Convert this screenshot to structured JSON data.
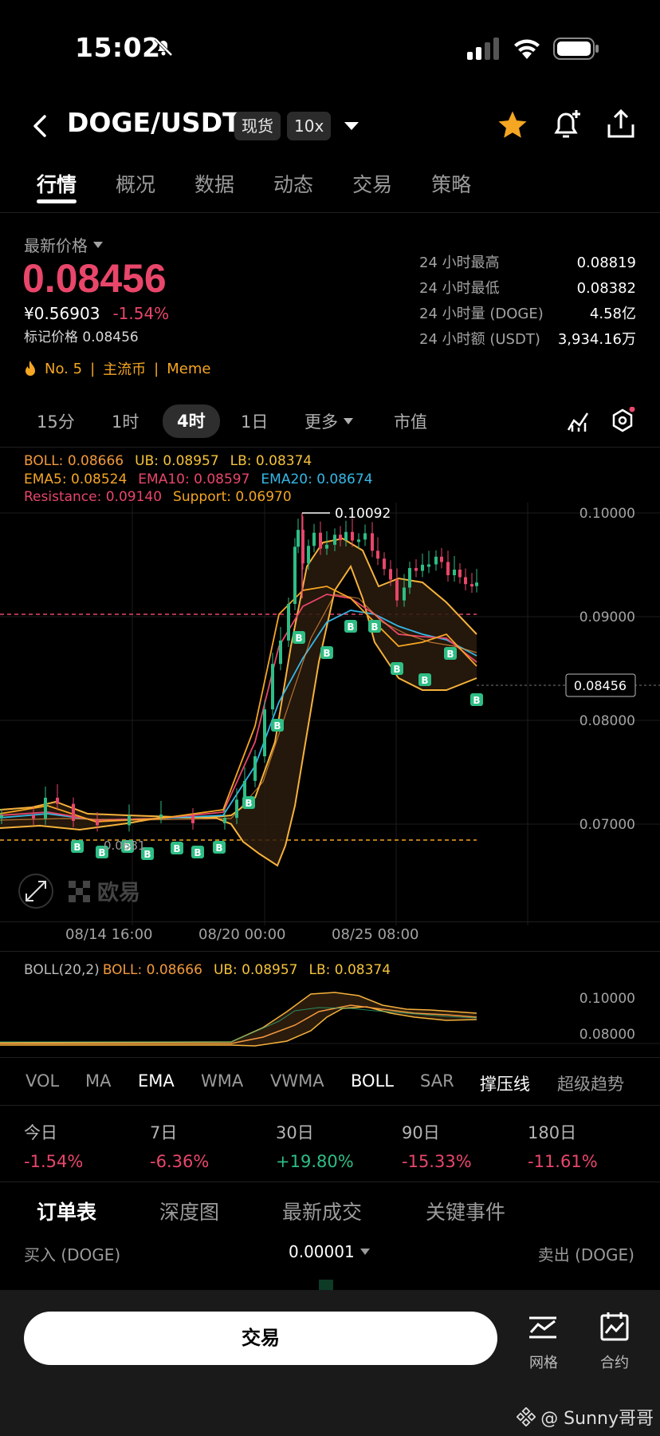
{
  "status": {
    "time": "15:02"
  },
  "header": {
    "title": "DOGE/USDT",
    "spot_tag": "现货",
    "leverage_tag": "10x"
  },
  "tabs": [
    "行情",
    "概况",
    "数据",
    "动态",
    "交易",
    "策略"
  ],
  "price": {
    "label": "最新价格",
    "last": "0.08456",
    "cny": "¥0.56903",
    "change": "-1.54%",
    "mark_label": "标记价格 0.08456",
    "rank": "No. 5",
    "tag1": "主流币",
    "tag2": "Meme"
  },
  "stats": [
    {
      "k": "24 小时最高",
      "v": "0.08819"
    },
    {
      "k": "24 小时最低",
      "v": "0.08382"
    },
    {
      "k": "24 小时量 (DOGE)",
      "v": "4.58亿"
    },
    {
      "k": "24 小时额 (USDT)",
      "v": "3,934.16万"
    }
  ],
  "timeframes": {
    "t15": "15分",
    "t1h": "1时",
    "t4h": "4时",
    "t1d": "1日",
    "more": "更多",
    "mcap": "市值"
  },
  "indicators": {
    "boll": "BOLL: 0.08666",
    "ub": "UB: 0.08957",
    "lb": "LB: 0.08374",
    "ema5": "EMA5: 0.08524",
    "ema10": "EMA10: 0.08597",
    "ema20": "EMA20: 0.08674",
    "resistance": "Resistance: 0.09140",
    "support": "Support: 0.06970"
  },
  "chart": {
    "y_labels": [
      "0.10000",
      "0.09000",
      "0.08000",
      "0.07000"
    ],
    "x_labels": [
      "08/14 16:00",
      "08/20 00:00",
      "08/25 08:00"
    ],
    "high_label": "0.10092",
    "low_label": "0.0681",
    "current_price": "0.08456",
    "watermark": "欧易"
  },
  "sub_chart": {
    "title": "BOLL(20,2)",
    "boll": "BOLL: 0.08666",
    "ub": "UB: 0.08957",
    "lb": "LB: 0.08374",
    "y_labels": [
      "0.10000",
      "0.08000"
    ]
  },
  "indicator_bar": [
    "VOL",
    "MA",
    "EMA",
    "WMA",
    "VWMA",
    "BOLL",
    "SAR",
    "撑压线",
    "超级趋势"
  ],
  "performance": [
    {
      "k": "今日",
      "v": "-1.54%"
    },
    {
      "k": "7日",
      "v": "-6.36%"
    },
    {
      "k": "30日",
      "v": "+19.80%"
    },
    {
      "k": "90日",
      "v": "-15.33%"
    },
    {
      "k": "180日",
      "v": "-11.61%"
    }
  ],
  "orderbook": {
    "tabs": [
      "订单表",
      "深度图",
      "最新成交",
      "关键事件"
    ],
    "buy": "买入 (DOGE)",
    "precision": "0.00001",
    "sell": "卖出 (DOGE)"
  },
  "bottom": {
    "trade": "交易",
    "grid": "网格",
    "contract": "合约",
    "watermark_text": "@ Sunny哥哥"
  }
}
